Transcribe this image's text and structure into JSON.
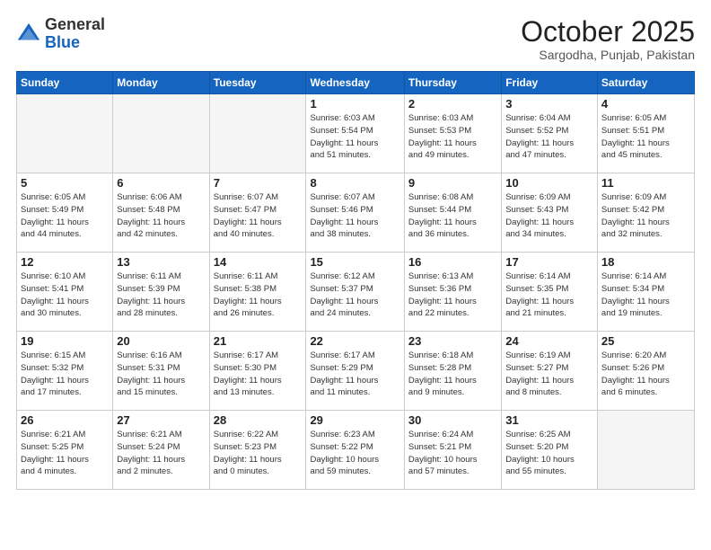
{
  "header": {
    "logo_general": "General",
    "logo_blue": "Blue",
    "month_year": "October 2025",
    "location": "Sargodha, Punjab, Pakistan"
  },
  "weekdays": [
    "Sunday",
    "Monday",
    "Tuesday",
    "Wednesday",
    "Thursday",
    "Friday",
    "Saturday"
  ],
  "weeks": [
    [
      {
        "day": "",
        "info": ""
      },
      {
        "day": "",
        "info": ""
      },
      {
        "day": "",
        "info": ""
      },
      {
        "day": "1",
        "info": "Sunrise: 6:03 AM\nSunset: 5:54 PM\nDaylight: 11 hours\nand 51 minutes."
      },
      {
        "day": "2",
        "info": "Sunrise: 6:03 AM\nSunset: 5:53 PM\nDaylight: 11 hours\nand 49 minutes."
      },
      {
        "day": "3",
        "info": "Sunrise: 6:04 AM\nSunset: 5:52 PM\nDaylight: 11 hours\nand 47 minutes."
      },
      {
        "day": "4",
        "info": "Sunrise: 6:05 AM\nSunset: 5:51 PM\nDaylight: 11 hours\nand 45 minutes."
      }
    ],
    [
      {
        "day": "5",
        "info": "Sunrise: 6:05 AM\nSunset: 5:49 PM\nDaylight: 11 hours\nand 44 minutes."
      },
      {
        "day": "6",
        "info": "Sunrise: 6:06 AM\nSunset: 5:48 PM\nDaylight: 11 hours\nand 42 minutes."
      },
      {
        "day": "7",
        "info": "Sunrise: 6:07 AM\nSunset: 5:47 PM\nDaylight: 11 hours\nand 40 minutes."
      },
      {
        "day": "8",
        "info": "Sunrise: 6:07 AM\nSunset: 5:46 PM\nDaylight: 11 hours\nand 38 minutes."
      },
      {
        "day": "9",
        "info": "Sunrise: 6:08 AM\nSunset: 5:44 PM\nDaylight: 11 hours\nand 36 minutes."
      },
      {
        "day": "10",
        "info": "Sunrise: 6:09 AM\nSunset: 5:43 PM\nDaylight: 11 hours\nand 34 minutes."
      },
      {
        "day": "11",
        "info": "Sunrise: 6:09 AM\nSunset: 5:42 PM\nDaylight: 11 hours\nand 32 minutes."
      }
    ],
    [
      {
        "day": "12",
        "info": "Sunrise: 6:10 AM\nSunset: 5:41 PM\nDaylight: 11 hours\nand 30 minutes."
      },
      {
        "day": "13",
        "info": "Sunrise: 6:11 AM\nSunset: 5:39 PM\nDaylight: 11 hours\nand 28 minutes."
      },
      {
        "day": "14",
        "info": "Sunrise: 6:11 AM\nSunset: 5:38 PM\nDaylight: 11 hours\nand 26 minutes."
      },
      {
        "day": "15",
        "info": "Sunrise: 6:12 AM\nSunset: 5:37 PM\nDaylight: 11 hours\nand 24 minutes."
      },
      {
        "day": "16",
        "info": "Sunrise: 6:13 AM\nSunset: 5:36 PM\nDaylight: 11 hours\nand 22 minutes."
      },
      {
        "day": "17",
        "info": "Sunrise: 6:14 AM\nSunset: 5:35 PM\nDaylight: 11 hours\nand 21 minutes."
      },
      {
        "day": "18",
        "info": "Sunrise: 6:14 AM\nSunset: 5:34 PM\nDaylight: 11 hours\nand 19 minutes."
      }
    ],
    [
      {
        "day": "19",
        "info": "Sunrise: 6:15 AM\nSunset: 5:32 PM\nDaylight: 11 hours\nand 17 minutes."
      },
      {
        "day": "20",
        "info": "Sunrise: 6:16 AM\nSunset: 5:31 PM\nDaylight: 11 hours\nand 15 minutes."
      },
      {
        "day": "21",
        "info": "Sunrise: 6:17 AM\nSunset: 5:30 PM\nDaylight: 11 hours\nand 13 minutes."
      },
      {
        "day": "22",
        "info": "Sunrise: 6:17 AM\nSunset: 5:29 PM\nDaylight: 11 hours\nand 11 minutes."
      },
      {
        "day": "23",
        "info": "Sunrise: 6:18 AM\nSunset: 5:28 PM\nDaylight: 11 hours\nand 9 minutes."
      },
      {
        "day": "24",
        "info": "Sunrise: 6:19 AM\nSunset: 5:27 PM\nDaylight: 11 hours\nand 8 minutes."
      },
      {
        "day": "25",
        "info": "Sunrise: 6:20 AM\nSunset: 5:26 PM\nDaylight: 11 hours\nand 6 minutes."
      }
    ],
    [
      {
        "day": "26",
        "info": "Sunrise: 6:21 AM\nSunset: 5:25 PM\nDaylight: 11 hours\nand 4 minutes."
      },
      {
        "day": "27",
        "info": "Sunrise: 6:21 AM\nSunset: 5:24 PM\nDaylight: 11 hours\nand 2 minutes."
      },
      {
        "day": "28",
        "info": "Sunrise: 6:22 AM\nSunset: 5:23 PM\nDaylight: 11 hours\nand 0 minutes."
      },
      {
        "day": "29",
        "info": "Sunrise: 6:23 AM\nSunset: 5:22 PM\nDaylight: 10 hours\nand 59 minutes."
      },
      {
        "day": "30",
        "info": "Sunrise: 6:24 AM\nSunset: 5:21 PM\nDaylight: 10 hours\nand 57 minutes."
      },
      {
        "day": "31",
        "info": "Sunrise: 6:25 AM\nSunset: 5:20 PM\nDaylight: 10 hours\nand 55 minutes."
      },
      {
        "day": "",
        "info": ""
      }
    ]
  ]
}
